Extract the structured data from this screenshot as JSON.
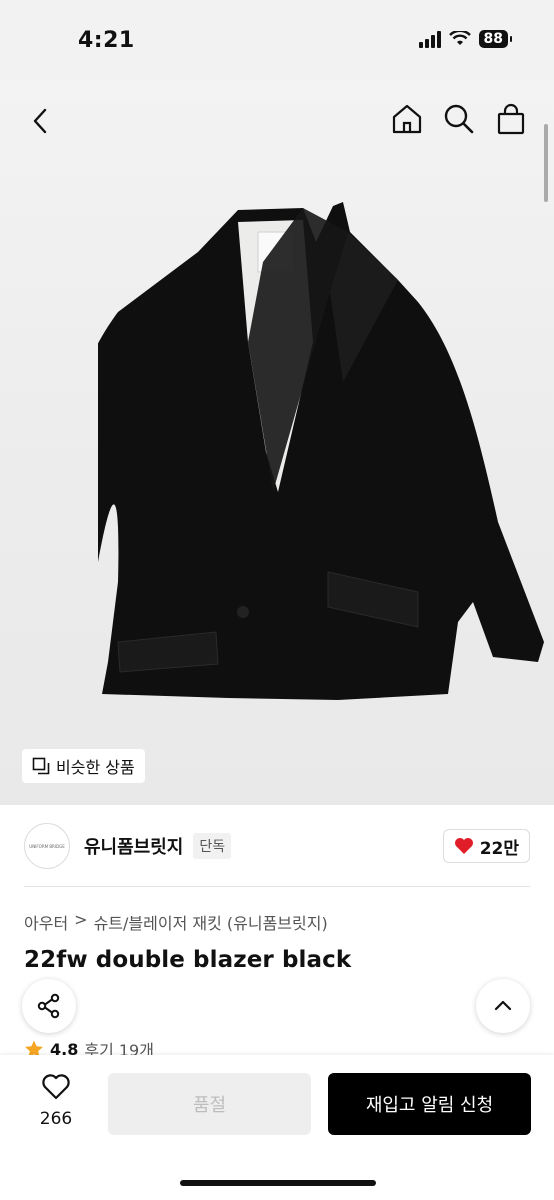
{
  "status": {
    "time": "4:21",
    "battery": "88"
  },
  "gallery": {
    "similar_label": "비슷한 상품"
  },
  "brand": {
    "logo_text": "UNIFORM BRIDGE",
    "name": "유니폼브릿지",
    "badge": "단독",
    "likes": "22만"
  },
  "breadcrumb": {
    "category": "아우터",
    "separator": ">",
    "subcategory": "슈트/블레이저 재킷 (유니폼브릿지)"
  },
  "product": {
    "title": "22fw double blazer black",
    "rating": "4.8",
    "reviews": "후기 19개"
  },
  "bottom": {
    "wish_count": "266",
    "soldout_label": "품절",
    "restock_label": "재입고 알림 신청"
  },
  "colors": {
    "heart": "#e11d2a",
    "star": "#f5a623",
    "primary": "#000000"
  }
}
